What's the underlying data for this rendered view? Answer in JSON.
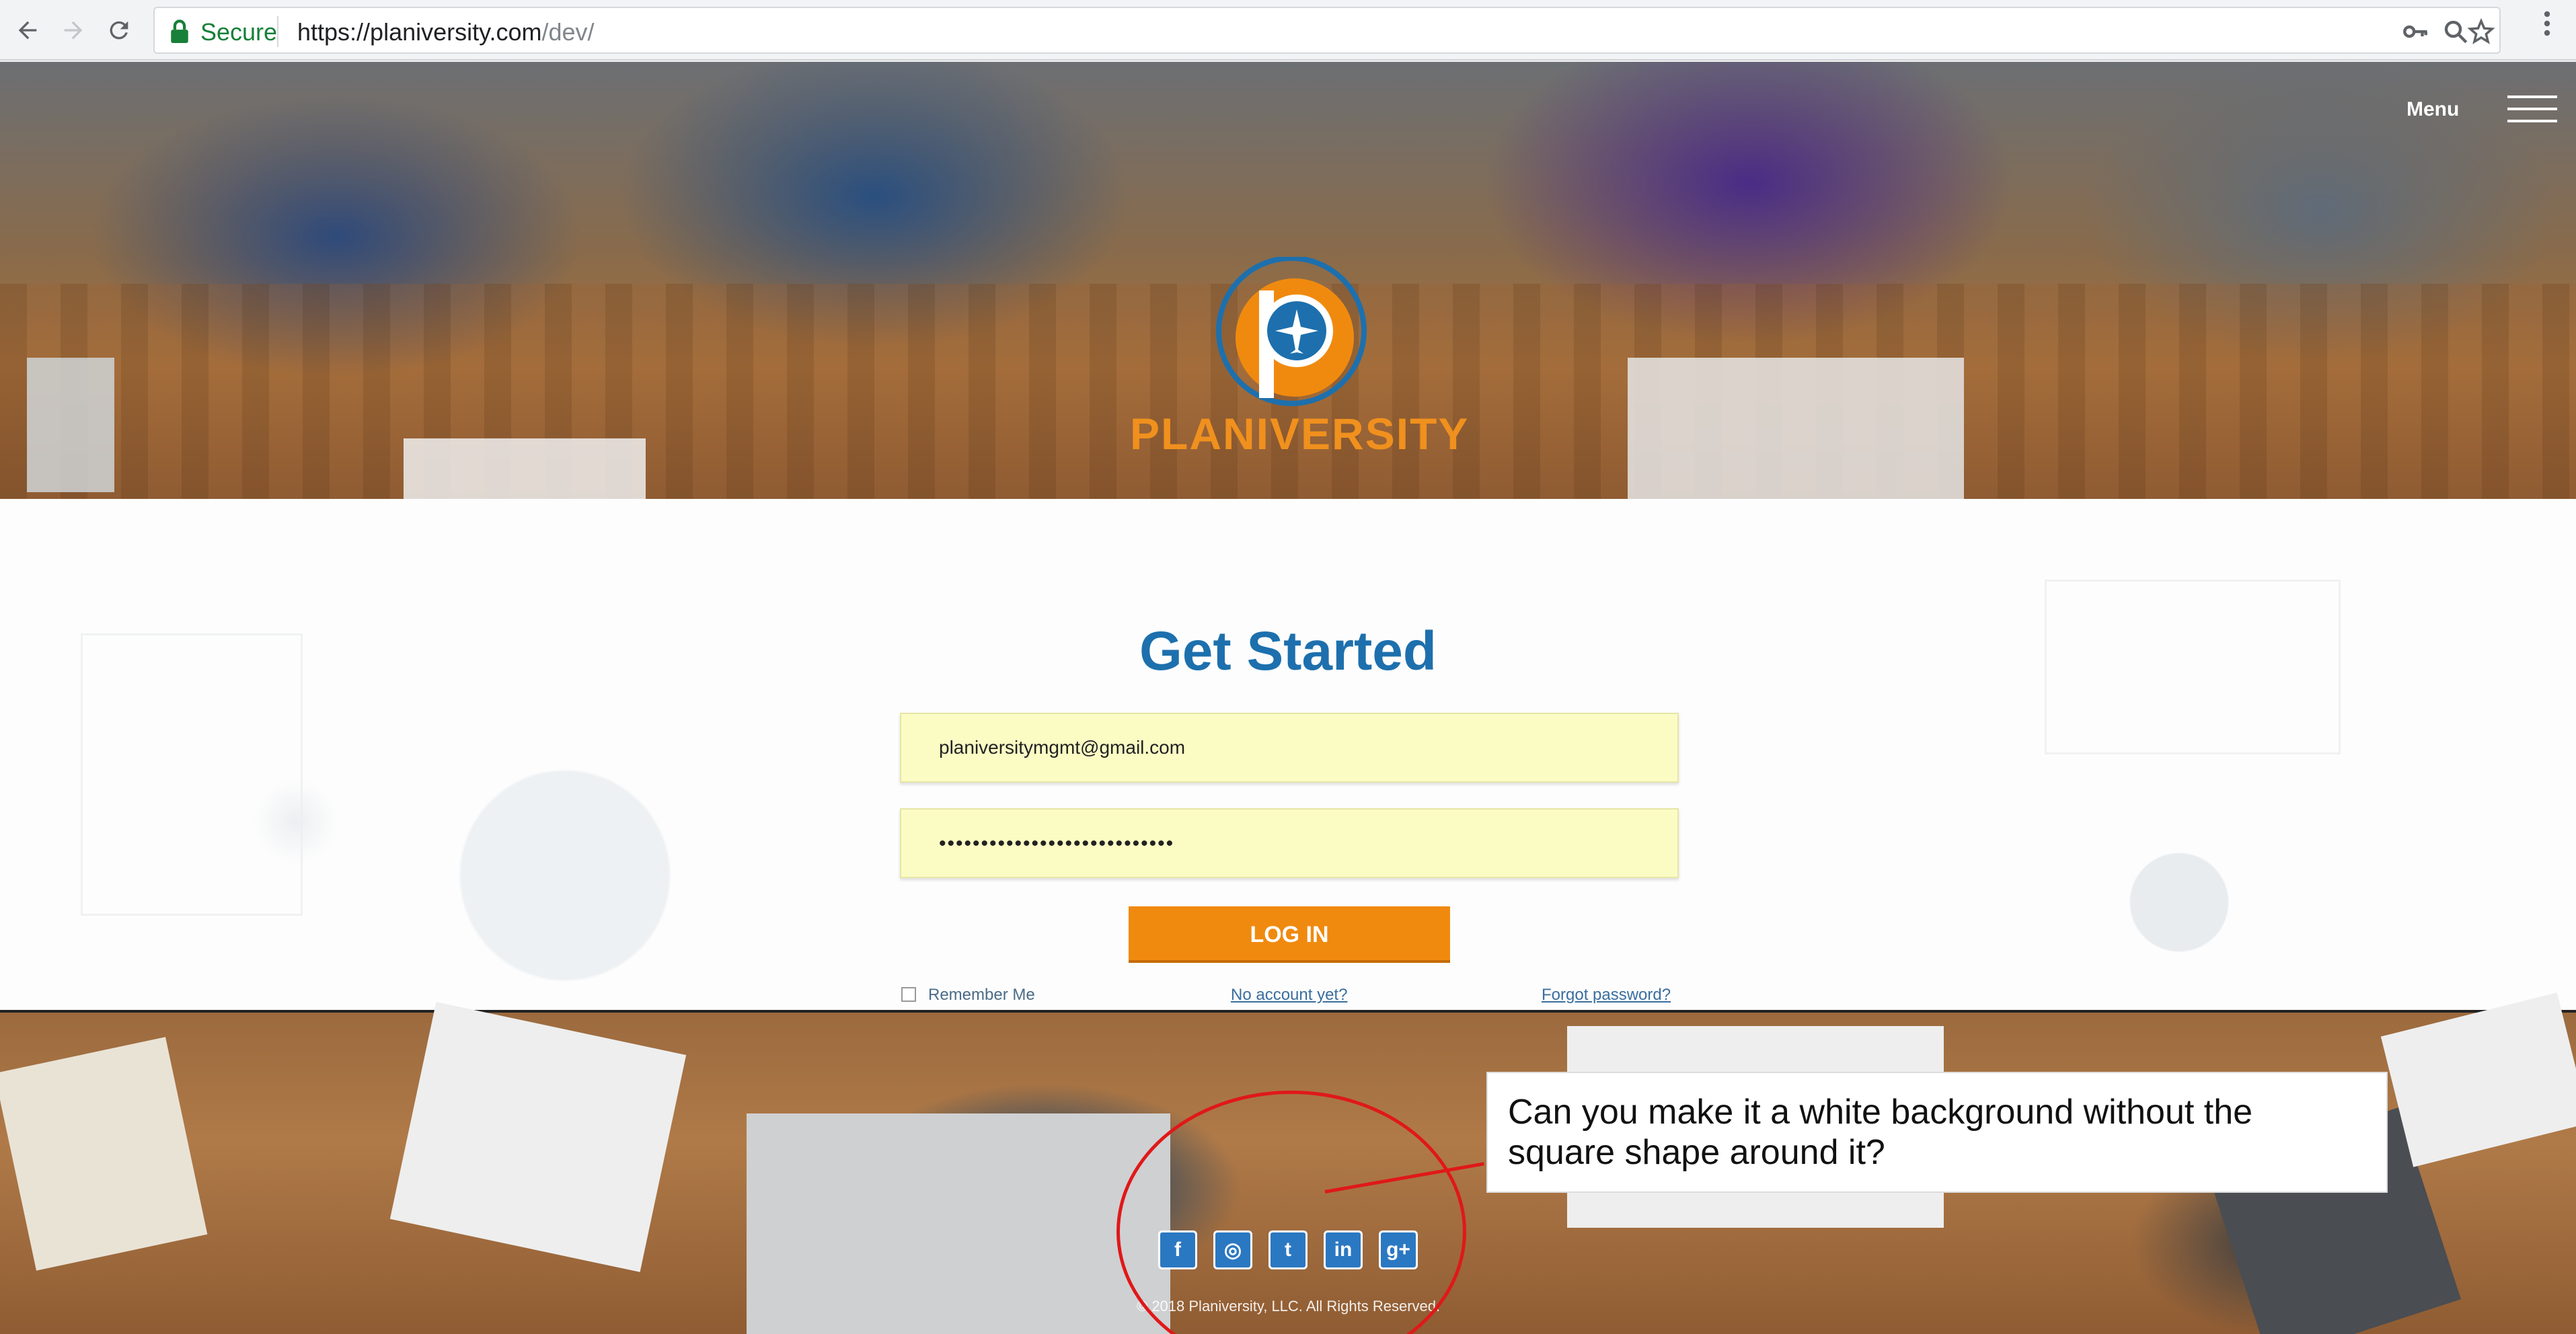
{
  "browser": {
    "secure_label": "Secure",
    "url_host": "https://planiversity.com",
    "url_path": "/dev/",
    "icons": [
      "back-arrow-icon",
      "forward-arrow-icon",
      "reload-icon",
      "lock-icon",
      "key-icon",
      "zoom-icon",
      "star-icon",
      "kebab-menu-icon"
    ]
  },
  "header": {
    "menu_label": "Menu",
    "logo_text": "PLANIVERSITY"
  },
  "login": {
    "title": "Get Started",
    "email_value": "planiversitymgmt@gmail.com",
    "password_value": "••••••••••••••••••••••••••••",
    "login_button": "LOG IN",
    "remember_label": "Remember Me",
    "no_account_link": "No account yet?",
    "forgot_link": "Forgot password?"
  },
  "footer": {
    "social": [
      {
        "name": "facebook-icon",
        "glyph": "f"
      },
      {
        "name": "instagram-icon",
        "glyph": "◎"
      },
      {
        "name": "twitter-icon",
        "glyph": "t"
      },
      {
        "name": "linkedin-icon",
        "glyph": "in"
      },
      {
        "name": "google-plus-icon",
        "glyph": "g+"
      }
    ],
    "copyright": "© 2018 Planiversity, LLC. All Rights Reserved."
  },
  "annotation": {
    "comment": "Can you make it a white background without the square shape around it?"
  },
  "colors": {
    "brand_orange": "#f08a0f",
    "title_blue": "#1d70ad",
    "field_yellow": "#fbfbc4",
    "annotation_red": "#e01818"
  }
}
